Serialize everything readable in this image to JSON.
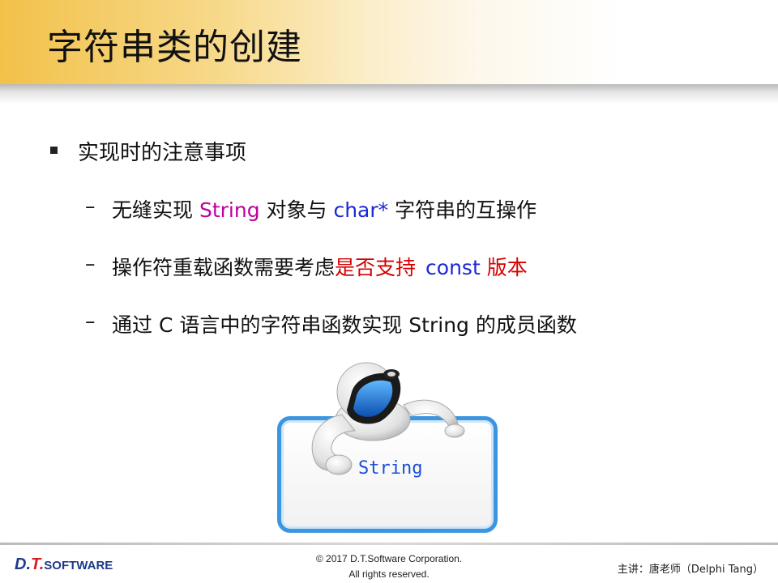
{
  "title": "字符串类的创建",
  "bullet": {
    "heading": "实现时的注意事项",
    "items": [
      {
        "dash": "–",
        "p1": "无缝实现 ",
        "p2": "String",
        "p3": " 对象与 ",
        "p4": "char*",
        "p5": " 字符串的互操作"
      },
      {
        "dash": "–",
        "p1": "操作符重载函数需要考虑",
        "p2": "是否支持",
        "p3": "const",
        "p4": " 版本"
      },
      {
        "dash": "–",
        "text": "通过 C 语言中的字符串函数实现 String 的成员函数"
      }
    ]
  },
  "illustration": {
    "board_label": "String"
  },
  "footer": {
    "logo_d": "D.",
    "logo_t": "T.",
    "logo_software": "SOFTWARE",
    "copyright_line1": "© 2017 D.T.Software Corporation.",
    "copyright_line2": "All rights reserved.",
    "presenter": "主讲：唐老师（Delphi Tang）"
  },
  "colors": {
    "title_gradient_start": "#f2c14a",
    "keyword_magenta": "#c0009a",
    "keyword_blue": "#1a27d6",
    "emphasis_red": "#d60000",
    "board_border": "#3b95e0",
    "logo_blue": "#1d3a8a",
    "logo_red": "#d21e1e"
  }
}
